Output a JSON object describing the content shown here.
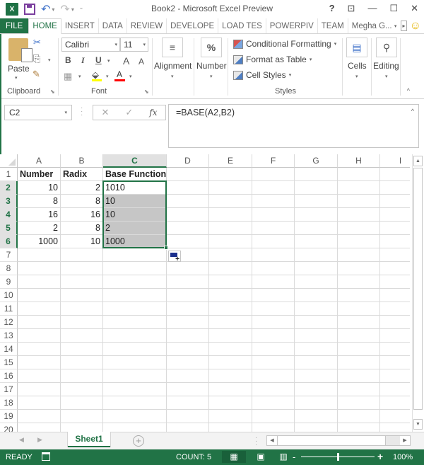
{
  "window": {
    "title": "Book2 - Microsoft Excel Preview",
    "help": "?",
    "restore_full": "⊡",
    "minimize": "—",
    "maximize": "☐",
    "close": "✕"
  },
  "qat": {
    "app_icon": "X",
    "undo": "↶",
    "redo": "↷",
    "customize": "⩸"
  },
  "tabs": [
    {
      "label": "FILE"
    },
    {
      "label": "HOME"
    },
    {
      "label": "INSERT"
    },
    {
      "label": "DATA"
    },
    {
      "label": "REVIEW"
    },
    {
      "label": "DEVELOPE"
    },
    {
      "label": "LOAD TES"
    },
    {
      "label": "POWERPIV"
    },
    {
      "label": "TEAM"
    }
  ],
  "user": {
    "name": "Megha G...",
    "scroll_arrow": "▸",
    "smiley": "☺"
  },
  "ribbon": {
    "clipboard": {
      "label": "Clipboard",
      "paste": "Paste",
      "cut": "✂",
      "copy": "⎘",
      "format_painter": "🖌"
    },
    "font": {
      "label": "Font",
      "name": "Calibri",
      "size": "11",
      "bold": "B",
      "italic": "I",
      "underline": "U",
      "grow": "A",
      "shrink": "A",
      "borders": "▦",
      "fill_color": "#ffff00",
      "font_color": "#ff0000",
      "font_color_letter": "A"
    },
    "alignment": {
      "label": "Alignment",
      "icon": "≡"
    },
    "number": {
      "label": "Number",
      "icon": "%"
    },
    "styles": {
      "label": "Styles",
      "conditional_formatting": "Conditional Formatting",
      "format_as_table": "Format as Table",
      "cell_styles": "Cell Styles"
    },
    "cells": {
      "label": "Cells",
      "icon": "▤"
    },
    "editing": {
      "label": "Editing",
      "icon": "⚲"
    },
    "collapse": "^"
  },
  "formula_bar": {
    "name_box": "C2",
    "cancel": "✕",
    "enter": "✓",
    "fx": "fx",
    "formula": "=BASE(A2,B2)",
    "expand": "^"
  },
  "sheet": {
    "columns": [
      "A",
      "B",
      "C",
      "D",
      "E",
      "F",
      "G",
      "H",
      "I"
    ],
    "selected_column": "C",
    "rows": [
      "1",
      "2",
      "3",
      "4",
      "5",
      "6",
      "7",
      "8",
      "9",
      "10",
      "11",
      "12",
      "13",
      "14",
      "15",
      "16",
      "17",
      "18",
      "19",
      "20"
    ],
    "selected_rows": [
      "2",
      "3",
      "4",
      "5",
      "6"
    ],
    "active_cell": "C2",
    "selection_range": "C2:C6",
    "headers": {
      "A": "Number",
      "B": "Radix",
      "C": "Base Function"
    },
    "data": [
      {
        "A": "10",
        "B": "2",
        "C": "1010"
      },
      {
        "A": "8",
        "B": "8",
        "C": "10"
      },
      {
        "A": "16",
        "B": "16",
        "C": "10"
      },
      {
        "A": "2",
        "B": "8",
        "C": "2"
      },
      {
        "A": "1000",
        "B": "10",
        "C": "1000"
      }
    ]
  },
  "scroll": {
    "up": "▲",
    "down": "▼",
    "left": "◀",
    "right": "▶"
  },
  "sheet_tabs": {
    "prev": "◀",
    "next": "▶",
    "tabs": [
      "Sheet1"
    ],
    "add": "+"
  },
  "status_bar": {
    "mode": "READY",
    "count": "COUNT: 5",
    "view_normal": "▦",
    "view_page_layout": "▣",
    "view_page_break": "▥",
    "zoom_minus": "-",
    "zoom_plus": "+",
    "zoom_level": "100%",
    "zoom_fraction": 0.5
  },
  "colors": {
    "brand_green": "#217346",
    "selection_fill": "#c6c6c6"
  }
}
